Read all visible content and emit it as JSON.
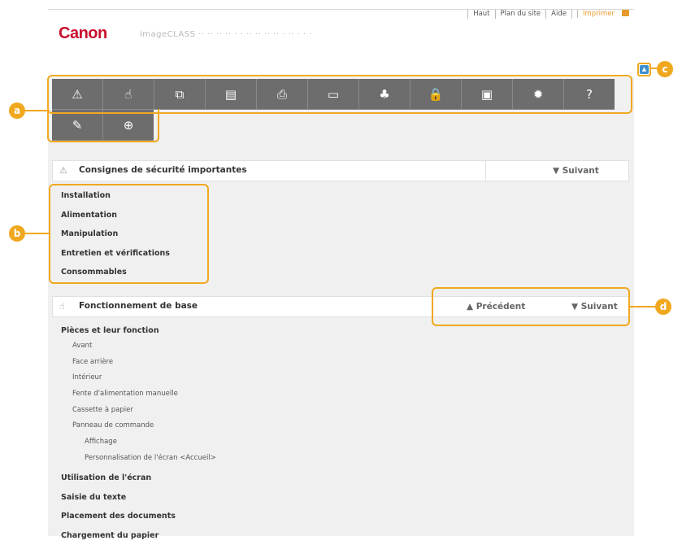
{
  "header": {
    "top_links": [
      "Haut",
      "Plan du site",
      "Aide"
    ],
    "print_label": "Imprimer",
    "logo": "Canon",
    "product_name": "imageCLASS ·· ·· ·· ·· · · ·· ·· ·· ·· · ·· · · ·"
  },
  "toolbar": {
    "row1": [
      {
        "icon": "warning-icon",
        "glyph": "⚠"
      },
      {
        "icon": "hand-pointer-icon",
        "glyph": "☝"
      },
      {
        "icon": "copy-icon",
        "glyph": "⧉"
      },
      {
        "icon": "fax-icon",
        "glyph": "▤"
      },
      {
        "icon": "printer-icon",
        "glyph": "⎙"
      },
      {
        "icon": "scanner-icon",
        "glyph": "▭"
      },
      {
        "icon": "network-icon",
        "glyph": "♣"
      },
      {
        "icon": "lock-icon",
        "glyph": "🔒"
      },
      {
        "icon": "remote-ui-icon",
        "glyph": "▣"
      },
      {
        "icon": "gear-icon",
        "glyph": "✹"
      },
      {
        "icon": "help-icon",
        "glyph": "?"
      }
    ],
    "row2": [
      {
        "icon": "wrench-icon",
        "glyph": "✎"
      },
      {
        "icon": "plus-circle-icon",
        "glyph": "⊕"
      }
    ]
  },
  "callouts": {
    "a": "a",
    "b": "b",
    "c": "c",
    "d": "d"
  },
  "section1": {
    "title": "Consignes de sécurité importantes",
    "next_label": "Suivant",
    "links": [
      "Installation",
      "Alimentation",
      "Manipulation",
      "Entretien et vérifications",
      "Consommables"
    ]
  },
  "section2": {
    "title": "Fonctionnement de base",
    "prev_label": "Précédent",
    "next_label": "Suivant",
    "group_title": "Pièces et leur fonction",
    "sub_items": [
      "Avant",
      "Face arrière",
      "Intérieur",
      "Fente d'alimentation manuelle",
      "Cassette à papier",
      "Panneau de commande"
    ],
    "sub_sub_items": [
      "Affichage",
      "Personnalisation de l'écran <Accueil>"
    ],
    "more_links": [
      "Utilisation de l'écran",
      "Saisie du texte",
      "Placement des documents",
      "Chargement du papier"
    ]
  },
  "colors": {
    "accent": "#f0a81e",
    "toolbar": "#6d6d6d",
    "brand": "#c8102e"
  }
}
